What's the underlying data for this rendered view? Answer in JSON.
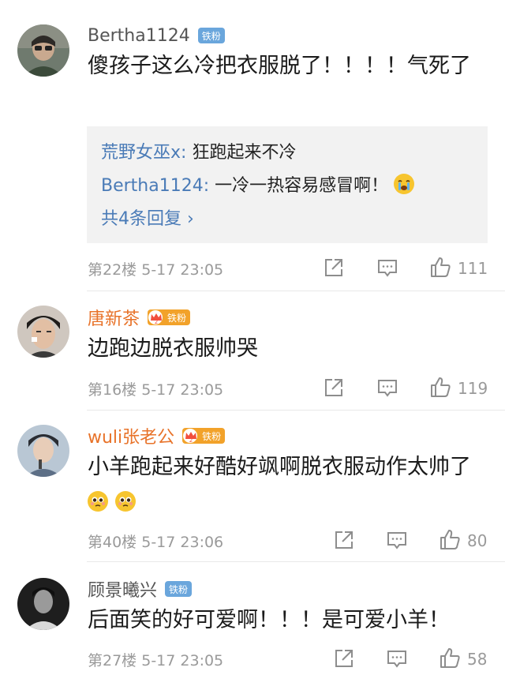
{
  "comments": [
    {
      "user": "Bertha1124",
      "badge": "铁粉",
      "text": "傻孩子这么冷把衣服脱了！！！！气死了",
      "replies": [
        {
          "name": "荒野女巫x",
          "sep": ": ",
          "text": "狂跑起来不冷"
        },
        {
          "name": "Bertha1124",
          "sep": ": ",
          "text": "一冷一热容易感冒啊！"
        }
      ],
      "more": "共4条回复 ›",
      "floor": "第22楼",
      "time": "5-17 23:05",
      "likes": "111"
    },
    {
      "user": "唐新茶",
      "badge": "铁粉",
      "text": "边跑边脱衣服帅哭",
      "floor": "第16楼",
      "time": "5-17 23:05",
      "likes": "119"
    },
    {
      "user": "wuli张老公",
      "badge": "铁粉",
      "text": "小羊跑起来好酷好飒啊脱衣服动作太帅了",
      "floor": "第40楼",
      "time": "5-17 23:06",
      "likes": "80"
    },
    {
      "user": "顾景曦兴",
      "badge": "铁粉",
      "text": "后面笑的好可爱啊！！！是可爱小羊！",
      "floor": "第27楼",
      "time": "5-17 23:05",
      "likes": "58"
    }
  ],
  "colors": {
    "link_blue": "#4a7bb7",
    "badge_blue": "#6aa6dc",
    "badge_gold": "#f2a22a",
    "vip_name": "#e8732a",
    "meta_gray": "#9a9a9a",
    "reply_bg": "#f2f2f2"
  },
  "icons": [
    "share-icon",
    "comment-icon",
    "like-icon",
    "crying-emoji-icon",
    "pleading-emoji-icon",
    "crown-icon"
  ]
}
